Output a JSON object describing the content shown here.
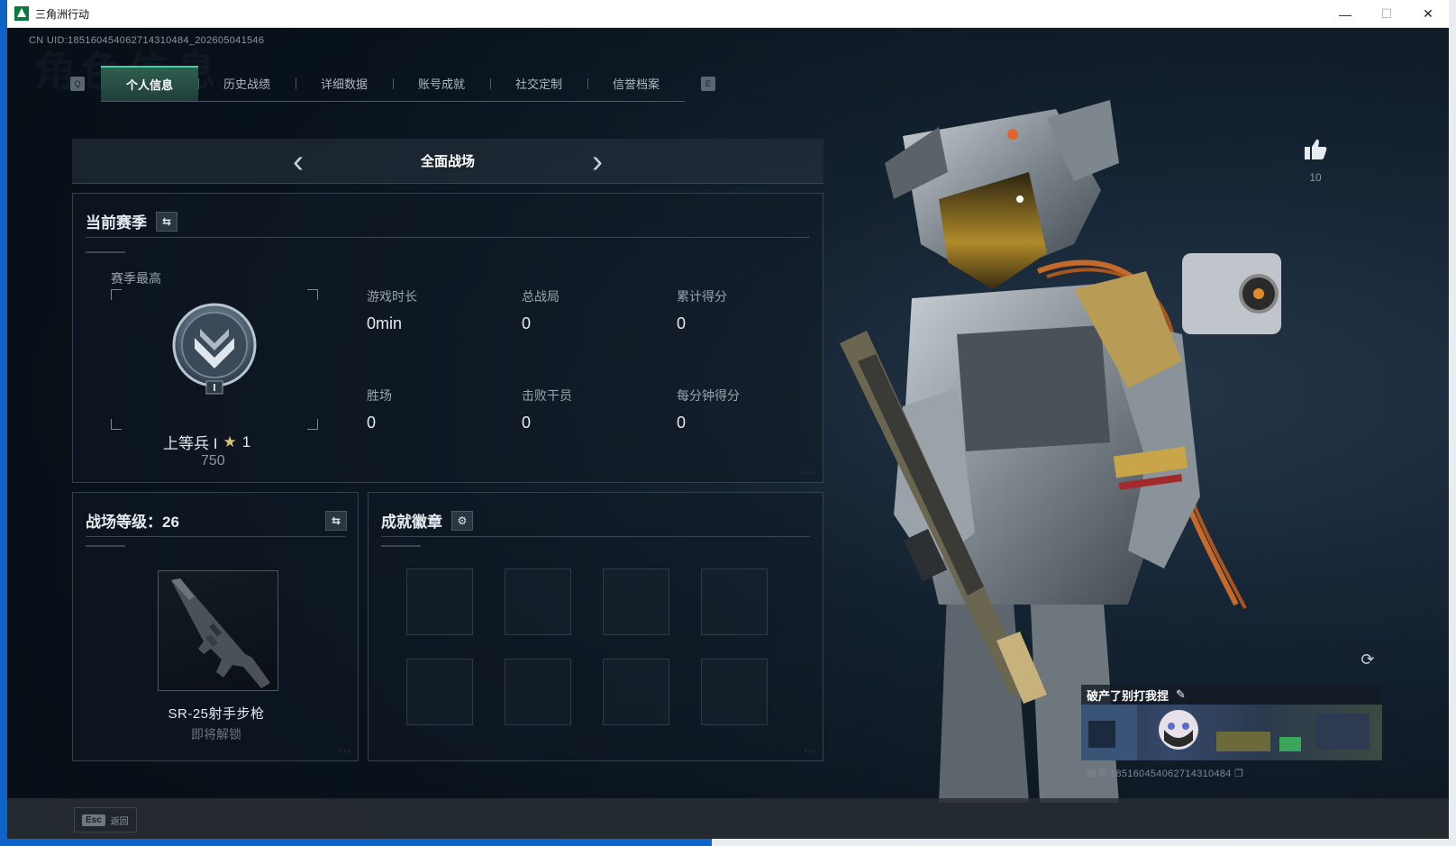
{
  "window": {
    "title": "三角洲行动",
    "buttons": [
      "—",
      "☐",
      "✕"
    ]
  },
  "header": {
    "uid": "CN UID:18516045406271431048​4_202605041546"
  },
  "tabs": {
    "left_key": "Q",
    "right_key": "E",
    "items": [
      {
        "label": "个人信息",
        "active": true
      },
      {
        "label": "历史战绩",
        "active": false
      },
      {
        "label": "详细数据",
        "active": false
      },
      {
        "label": "账号成就",
        "active": false
      },
      {
        "label": "社交定制",
        "active": false
      },
      {
        "label": "信誉档案",
        "active": false
      }
    ]
  },
  "mode": {
    "label": "全面战场",
    "prev_icon": "chevron-left-icon",
    "next_icon": "chevron-right-icon"
  },
  "season": {
    "title": "当前赛季",
    "sub": "赛季最高",
    "rank_name": "上等兵 I",
    "rank_stars": "1",
    "rank_points": "750",
    "stats": [
      {
        "key": "游戏时长",
        "value": "0min"
      },
      {
        "key": "总战局",
        "value": "0"
      },
      {
        "key": "累计得分",
        "value": "0"
      },
      {
        "key": "胜场",
        "value": "0"
      },
      {
        "key": "击败干员",
        "value": "0"
      },
      {
        "key": "每分钟得分",
        "value": "0"
      }
    ]
  },
  "level": {
    "title": "战场等级：26",
    "weapon_name": "SR-25射手步枪",
    "weapon_status": "即将解锁"
  },
  "achievements": {
    "title": "成就徽章"
  },
  "profile": {
    "likes": "10",
    "card_name": "破产了别打我捏",
    "card_id": "编号:18516045406271431048​4"
  },
  "footer": {
    "esc_key": "Esc",
    "esc_label": "返回"
  },
  "colors": {
    "accent": "#3fd19a",
    "background": "#0d1822",
    "panel_border": "#33414d"
  }
}
